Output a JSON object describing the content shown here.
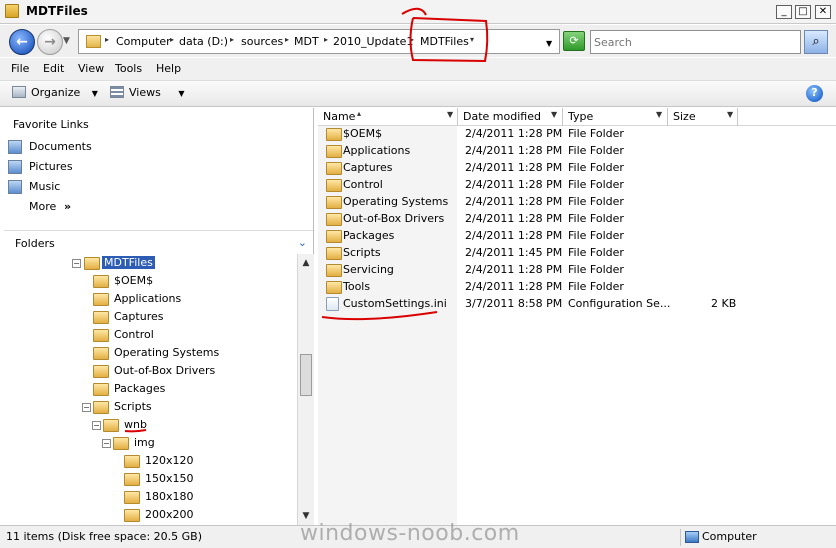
{
  "window": {
    "title": "MDTFiles",
    "minimize_glyph": "_",
    "maximize_glyph": "□",
    "close_glyph": "✕"
  },
  "address": {
    "crumbs": [
      "Computer",
      "data (D:)",
      "sources",
      "MDT",
      "2010_Update1",
      "MDTFiles"
    ],
    "search_placeholder": "Search"
  },
  "menu": {
    "items": [
      "File",
      "Edit",
      "View",
      "Tools",
      "Help"
    ]
  },
  "toolbar": {
    "organize": "Organize",
    "views": "Views"
  },
  "favorites": {
    "title": "Favorite Links",
    "items": [
      "Documents",
      "Pictures",
      "Music"
    ],
    "more": "More"
  },
  "folders": {
    "title": "Folders",
    "tree": [
      {
        "label": "MDTFiles",
        "toggle": "−",
        "selected": true
      },
      {
        "label": "$OEM$"
      },
      {
        "label": "Applications"
      },
      {
        "label": "Captures"
      },
      {
        "label": "Control"
      },
      {
        "label": "Operating Systems"
      },
      {
        "label": "Out-of-Box Drivers"
      },
      {
        "label": "Packages"
      },
      {
        "label": "Scripts",
        "toggle": "−"
      },
      {
        "label": "wnb",
        "toggle": "−"
      },
      {
        "label": "img",
        "toggle": "−"
      },
      {
        "label": "120x120"
      },
      {
        "label": "150x150"
      },
      {
        "label": "180x180"
      },
      {
        "label": "200x200"
      }
    ]
  },
  "columns": {
    "name": "Name",
    "date": "Date modified",
    "type": "Type",
    "size": "Size"
  },
  "files": [
    {
      "name": "$OEM$",
      "date": "2/4/2011 1:28 PM",
      "type": "File Folder",
      "size": ""
    },
    {
      "name": "Applications",
      "date": "2/4/2011 1:28 PM",
      "type": "File Folder",
      "size": ""
    },
    {
      "name": "Captures",
      "date": "2/4/2011 1:28 PM",
      "type": "File Folder",
      "size": ""
    },
    {
      "name": "Control",
      "date": "2/4/2011 1:28 PM",
      "type": "File Folder",
      "size": ""
    },
    {
      "name": "Operating Systems",
      "date": "2/4/2011 1:28 PM",
      "type": "File Folder",
      "size": ""
    },
    {
      "name": "Out-of-Box Drivers",
      "date": "2/4/2011 1:28 PM",
      "type": "File Folder",
      "size": ""
    },
    {
      "name": "Packages",
      "date": "2/4/2011 1:28 PM",
      "type": "File Folder",
      "size": ""
    },
    {
      "name": "Scripts",
      "date": "2/4/2011 1:45 PM",
      "type": "File Folder",
      "size": ""
    },
    {
      "name": "Servicing",
      "date": "2/4/2011 1:28 PM",
      "type": "File Folder",
      "size": ""
    },
    {
      "name": "Tools",
      "date": "2/4/2011 1:28 PM",
      "type": "File Folder",
      "size": ""
    },
    {
      "name": "CustomSettings.ini",
      "date": "3/7/2011 8:58 PM",
      "type": "Configuration Se...",
      "size": "2 KB"
    }
  ],
  "status": {
    "summary": "11 items (Disk free space: 20.5 GB)",
    "location": "Computer",
    "watermark": "windows-noob.com"
  },
  "colors": {
    "annotation": "#d90000",
    "selection": "#2c5cb3"
  }
}
